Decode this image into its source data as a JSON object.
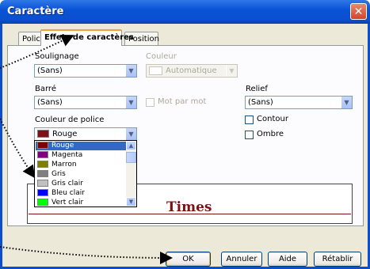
{
  "window": {
    "title": "Caractère",
    "close_label": "✕"
  },
  "tabs": [
    {
      "label": "Police"
    },
    {
      "label": "Effets de caractères"
    },
    {
      "label": "Position"
    }
  ],
  "form": {
    "soulignage_label": "Soulignage",
    "soulignage_value": "(Sans)",
    "couleur_label": "Couleur",
    "couleur_value": "Automatique",
    "barre_label": "Barré",
    "barre_value": "(Sans)",
    "mot_par_mot_label": "Mot par mot",
    "relief_label": "Relief",
    "relief_value": "(Sans)",
    "contour_label": "Contour",
    "ombre_label": "Ombre",
    "couleur_police_label": "Couleur de police",
    "couleur_police_value": "Rouge",
    "couleur_police_color": "#7b1316"
  },
  "color_list": [
    {
      "name": "Rouge",
      "color": "#800000",
      "selected": true
    },
    {
      "name": "Magenta",
      "color": "#800080",
      "selected": false
    },
    {
      "name": "Marron",
      "color": "#808000",
      "selected": false
    },
    {
      "name": "Gris",
      "color": "#808080",
      "selected": false
    },
    {
      "name": "Gris clair",
      "color": "#c0c0c0",
      "selected": false
    },
    {
      "name": "Bleu clair",
      "color": "#0000ff",
      "selected": false
    },
    {
      "name": "Vert clair",
      "color": "#00ff00",
      "selected": false
    }
  ],
  "preview": {
    "text": "Times"
  },
  "buttons": {
    "ok": "OK",
    "annuler": "Annuler",
    "aide": "Aide",
    "retablir": "Rétablir"
  },
  "colors": {
    "titlebar": "#0a53d6",
    "accent_text": "#7b1316",
    "selection": "#316ac5"
  }
}
